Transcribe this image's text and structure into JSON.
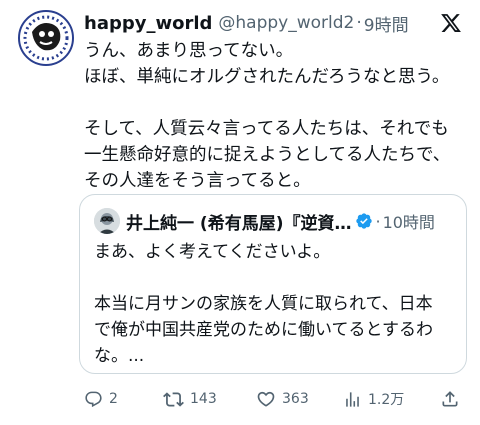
{
  "author": {
    "display_name": "happy_world",
    "handle": "@happy_world2",
    "separator": "·",
    "time": "9時間"
  },
  "tweet": {
    "lines_a": [
      "うん、あまり思ってない。",
      "ほぼ、単純にオルグされたんだろうなと思う。"
    ],
    "lines_b": [
      "そして、人質云々言ってる人たちは、それでも",
      "一生懸命好意的に捉えようとしてる人たちで、",
      "その人達をそう言ってると。"
    ]
  },
  "quote": {
    "display_name": "井上純一 (希有馬屋)『逆資…",
    "separator": "·",
    "time": "10時間",
    "lines_a": [
      "まあ、よく考えてくださいよ。"
    ],
    "lines_b": [
      "本当に月サンの家族を人質に取られて、日本",
      "で俺が中国共産党のために働いてるとするわ",
      "な。..."
    ]
  },
  "actions": {
    "reply_count": "2",
    "retweet_count": "143",
    "like_count": "363",
    "view_count": "1.2万"
  },
  "icons": [
    "x-logo-icon",
    "verified-badge-icon",
    "reply-icon",
    "retweet-icon",
    "like-icon",
    "views-icon",
    "share-icon"
  ],
  "colors": {
    "text": "#0f1419",
    "secondary": "#536471",
    "border": "#cfd9de",
    "verified": "#1d9bf0"
  }
}
